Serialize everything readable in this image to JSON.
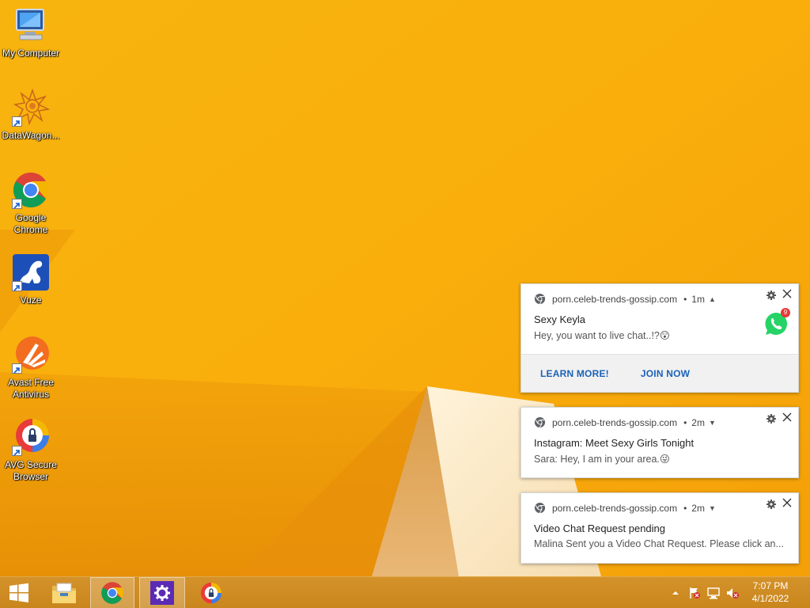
{
  "desktop": {
    "icons": [
      {
        "label": "My Computer",
        "icon": "computer-icon"
      },
      {
        "label": "DataWagon...",
        "icon": "datawagon-icon"
      },
      {
        "label": "Google Chrome",
        "icon": "chrome-icon"
      },
      {
        "label": "Vuze",
        "icon": "vuze-icon"
      },
      {
        "label": "Avast Free Antivirus",
        "icon": "avast-icon"
      },
      {
        "label": "AVG Secure Browser",
        "icon": "avg-browser-icon"
      }
    ]
  },
  "notifications": [
    {
      "source": "porn.celeb-trends-gossip.com",
      "age": "1m",
      "title": "Sexy Keyla",
      "message": "Hey, you want to live chat..!?😲",
      "badge_count": "9",
      "icon": "whatsapp-icon",
      "actions": [
        "LEARN MORE!",
        "JOIN NOW"
      ]
    },
    {
      "source": "porn.celeb-trends-gossip.com",
      "age": "2m",
      "title": "Instagram: Meet Sexy Girls Tonight",
      "message": "Sara: Hey, I am in your area.😜"
    },
    {
      "source": "porn.celeb-trends-gossip.com",
      "age": "2m",
      "title": "Video Chat Request pending",
      "message": "Malina Sent you a Video Chat Request. Please click an..."
    }
  ],
  "taskbar": {
    "pinned": [
      "start-icon",
      "file-explorer-icon",
      "chrome-icon",
      "settings-icon",
      "avg-browser-icon"
    ],
    "clock": {
      "time": "7:07 PM",
      "date": "4/1/2022"
    },
    "tray_icons": [
      "show-hidden-icons-icon",
      "action-center-flag-icon",
      "network-icon",
      "volume-muted-icon"
    ]
  },
  "colors": {
    "wallpaper": "#f7a70a",
    "taskbar": "#c9861d",
    "link_blue": "#1a62b8",
    "whatsapp_green": "#25d366"
  }
}
